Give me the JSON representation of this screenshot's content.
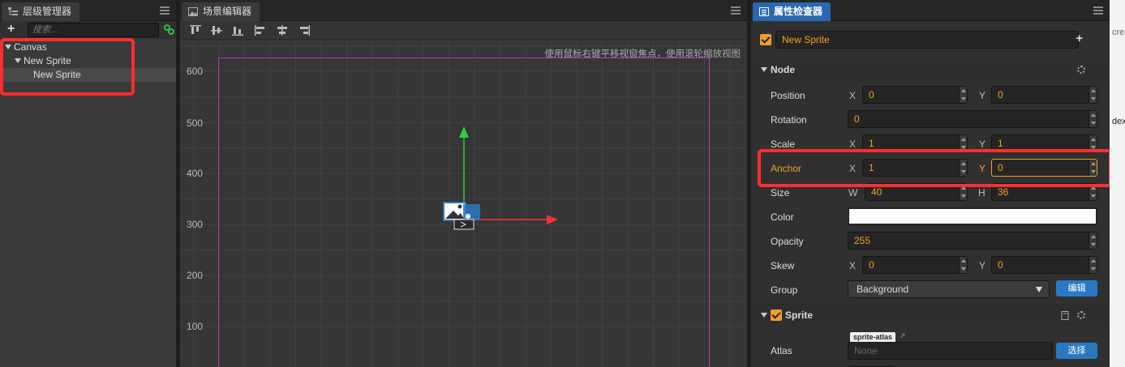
{
  "hierarchy": {
    "tab_title": "层级管理器",
    "search_placeholder": "搜索...",
    "tree": [
      {
        "label": "Canvas"
      },
      {
        "label": "New Sprite"
      },
      {
        "label": "New Sprite"
      }
    ]
  },
  "scene": {
    "tab_title": "场景编辑器",
    "hint": "使用鼠标右键平移视窗焦点，使用滚轮缩放视图",
    "y_labels": [
      "600",
      "500",
      "400",
      "300",
      "200",
      "100"
    ]
  },
  "inspector": {
    "tab_title": "属性检查器",
    "node_name": "New Sprite",
    "node_section": "Node",
    "position": {
      "label": "Position",
      "x_label": "X",
      "x": "0",
      "y_label": "Y",
      "y": "0"
    },
    "rotation": {
      "label": "Rotation",
      "value": "0"
    },
    "scale": {
      "label": "Scale",
      "x_label": "X",
      "x": "1",
      "y_label": "Y",
      "y": "1"
    },
    "anchor": {
      "label": "Anchor",
      "x_label": "X",
      "x": "1",
      "y_label": "Y",
      "y": "0"
    },
    "size": {
      "label": "Size",
      "w_label": "W",
      "w": "40",
      "h_label": "H",
      "h": "36"
    },
    "color": {
      "label": "Color",
      "value": "#ffffff"
    },
    "opacity": {
      "label": "Opacity",
      "value": "255"
    },
    "skew": {
      "label": "Skew",
      "x_label": "X",
      "x": "0",
      "y_label": "Y",
      "y": "0"
    },
    "group": {
      "label": "Group",
      "value": "Background",
      "edit_button": "编辑"
    },
    "sprite_section": "Sprite",
    "atlas": {
      "label": "Atlas",
      "tag": "sprite-atlas",
      "value": "None",
      "select_button": "选择"
    }
  },
  "edge": {
    "text_top": "cre",
    "text_mid": "dex"
  },
  "colors": {
    "accent": "#f0a020",
    "tab_blue": "#2968b0",
    "highlight_red": "#ff2d2d",
    "canvas_border": "#b23bb8"
  }
}
